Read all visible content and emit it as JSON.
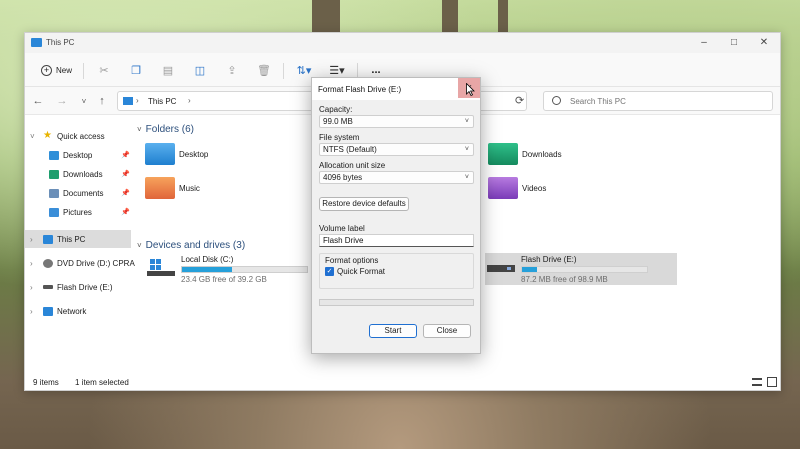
{
  "explorer": {
    "title": "This PC",
    "toolbar": {
      "new_label": "New",
      "more_label": "..."
    },
    "address": {
      "crumb": "This PC",
      "search_placeholder": "Search This PC"
    },
    "sidebar": {
      "quick_access": "Quick access",
      "items": [
        {
          "label": "Desktop",
          "icon": "desktop-icon"
        },
        {
          "label": "Downloads",
          "icon": "downloads-icon"
        },
        {
          "label": "Documents",
          "icon": "documents-icon"
        },
        {
          "label": "Pictures",
          "icon": "pictures-icon"
        }
      ],
      "this_pc": "This PC",
      "dvd": "DVD Drive (D:) CPRA",
      "flash": "Flash Drive (E:)",
      "network": "Network"
    },
    "folders_header": "Folders (6)",
    "folders": [
      {
        "label": "Desktop"
      },
      {
        "label": "Downloads"
      },
      {
        "label": "Music"
      },
      {
        "label": "Videos"
      }
    ],
    "drives_header": "Devices and drives (3)",
    "drives": [
      {
        "name": "Local Disk (C:)",
        "free": "23.4 GB free of 39.2 GB",
        "used_fraction": 0.4
      },
      {
        "name": "Flash Drive (E:)",
        "free": "87.2 MB free of 98.9 MB",
        "used_fraction": 0.12
      }
    ],
    "status": {
      "items": "9 items",
      "selected": "1 item selected"
    }
  },
  "dialog": {
    "title": "Format Flash Drive (E:)",
    "close_glyph": "×",
    "capacity_label": "Capacity:",
    "capacity_value": "99.0 MB",
    "filesystem_label": "File system",
    "filesystem_value": "NTFS (Default)",
    "allocation_label": "Allocation unit size",
    "allocation_value": "4096 bytes",
    "restore_label": "Restore device defaults",
    "volume_label": "Volume label",
    "volume_value": "Flash Drive",
    "format_options_label": "Format options",
    "quick_format_label": "Quick Format",
    "quick_format_checked": true,
    "progress_fraction": 0,
    "start_label": "Start",
    "close_label": "Close"
  },
  "colors": {
    "accent": "#26a0da",
    "folder_yellow": "#f2c14e",
    "close_hover": "#e8a6a6"
  }
}
